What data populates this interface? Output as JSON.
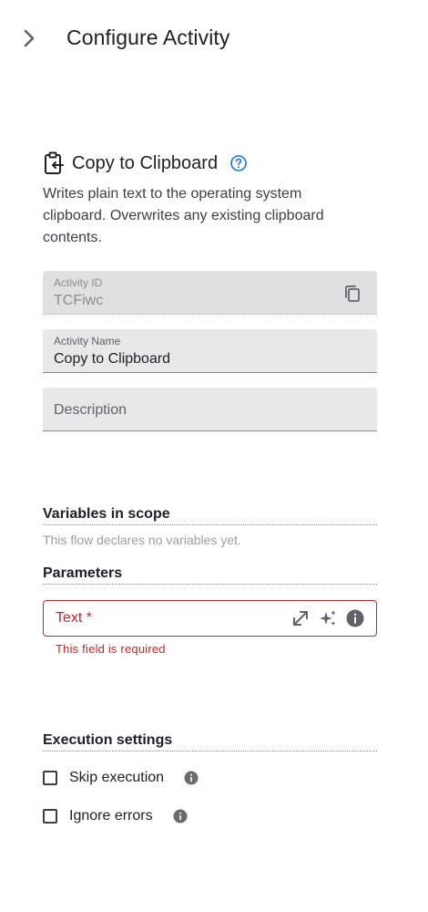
{
  "header": {
    "title": "Configure Activity"
  },
  "activity": {
    "title": "Copy to Clipboard",
    "description": "Writes plain text to the operating system clipboard. Overwrites any existing clipboard contents."
  },
  "fields": {
    "activity_id": {
      "label": "Activity ID",
      "value": "TCFiwc"
    },
    "activity_name": {
      "label": "Activity Name",
      "value": "Copy to Clipboard"
    },
    "description": {
      "placeholder": "Description"
    }
  },
  "variables": {
    "title": "Variables in scope",
    "empty_text": "This flow declares no variables yet."
  },
  "parameters": {
    "title": "Parameters",
    "text_field": {
      "label": "Text",
      "required_marker": " *",
      "error": "This field is required"
    }
  },
  "execution": {
    "title": "Execution settings",
    "skip_label": "Skip execution",
    "ignore_label": "Ignore errors"
  },
  "colors": {
    "error": "#c62828",
    "help": "#1a73e8",
    "field_bg": "#e8e8e8"
  }
}
